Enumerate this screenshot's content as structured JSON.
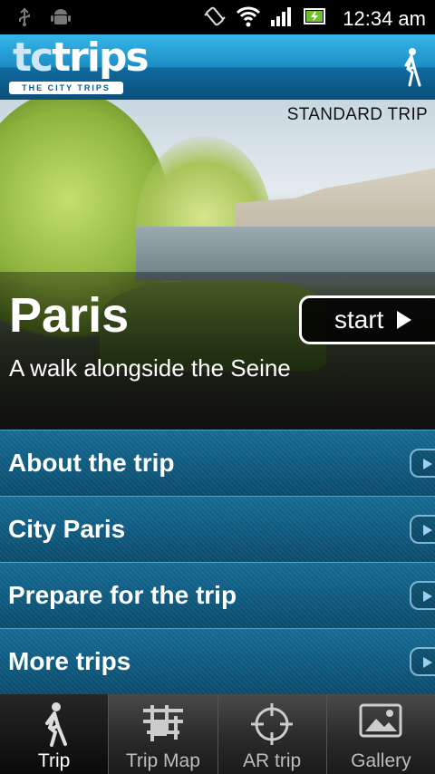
{
  "status_bar": {
    "time": "12:34 am"
  },
  "header": {
    "logo_main": "tctrips",
    "logo_tc": "tc",
    "logo_trips": "trips",
    "logo_sub": "THE CITY TRIPS"
  },
  "hero": {
    "trip_type": "STANDARD TRIP",
    "city": "Paris",
    "subtitle": "A walk alongside the Seine",
    "start_label": "start"
  },
  "menu": {
    "items": [
      {
        "label": "About the trip"
      },
      {
        "label": "City Paris"
      },
      {
        "label": "Prepare for the trip"
      },
      {
        "label": "More trips"
      }
    ]
  },
  "tabs": [
    {
      "label": "Trip",
      "icon": "walker-icon",
      "active": true
    },
    {
      "label": "Trip Map",
      "icon": "map-icon",
      "active": false
    },
    {
      "label": "AR trip",
      "icon": "crosshair-icon",
      "active": false
    },
    {
      "label": "Gallery",
      "icon": "picture-icon",
      "active": false
    }
  ],
  "colors": {
    "accent": "#1c8dc5",
    "menu_bg": "#0d587d"
  }
}
